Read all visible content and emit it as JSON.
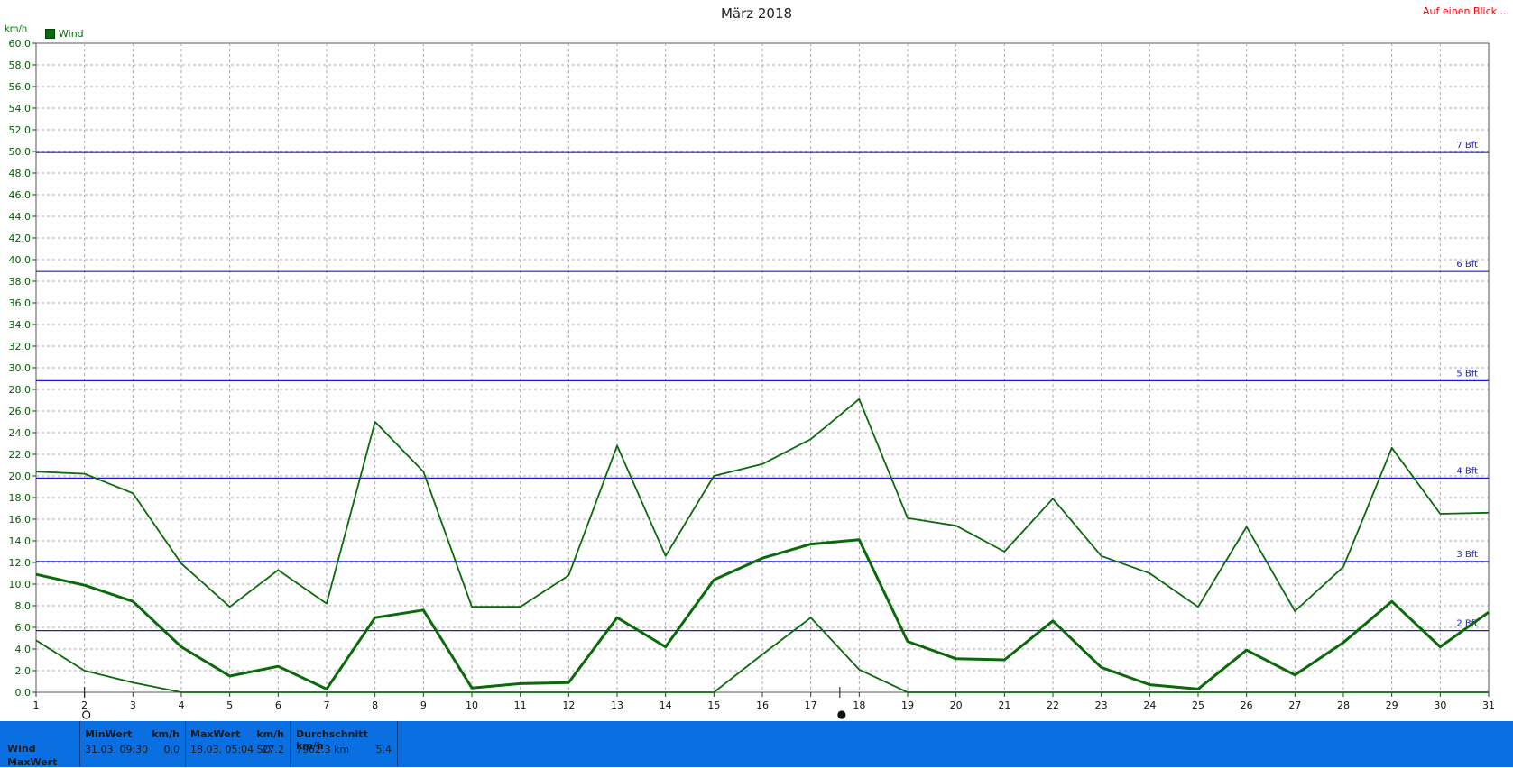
{
  "header": {
    "title": "März 2018",
    "overview_link": "Auf einen Blick ..."
  },
  "legend": {
    "unit": "km/h",
    "series_label": "Wind"
  },
  "colors": {
    "line": "#0a6a0a",
    "beaufort": "#1a1adb",
    "grid": "#a8a8a8",
    "stats_bg": "#0a6fe0",
    "link": "#ff0000"
  },
  "markers": {
    "min_day": 2,
    "max_day": 17.6
  },
  "chart_data": {
    "type": "line",
    "title": "März 2018",
    "ylabel": "km/h",
    "ylim": [
      0,
      60
    ],
    "xlim": [
      1,
      31
    ],
    "ytick_step": 2,
    "grid": true,
    "legend_position": "top-left",
    "x": [
      1,
      2,
      3,
      4,
      5,
      6,
      7,
      8,
      9,
      10,
      11,
      12,
      13,
      14,
      15,
      16,
      17,
      18,
      19,
      20,
      21,
      22,
      23,
      24,
      25,
      26,
      27,
      28,
      29,
      30,
      31
    ],
    "series": [
      {
        "name": "Wind",
        "role": "max",
        "values": [
          20.4,
          20.2,
          18.4,
          11.9,
          7.9,
          11.3,
          8.2,
          25.0,
          20.4,
          7.9,
          7.9,
          10.8,
          22.8,
          12.6,
          20.0,
          21.1,
          23.4,
          27.1,
          16.1,
          15.4,
          13.0,
          17.9,
          12.6,
          11.0,
          7.9,
          15.3,
          7.5,
          11.6,
          22.6,
          16.5,
          16.6
        ]
      },
      {
        "role": "avg",
        "values": [
          10.9,
          9.9,
          8.4,
          4.2,
          1.5,
          2.4,
          0.3,
          6.9,
          7.6,
          0.4,
          0.8,
          0.9,
          6.9,
          4.2,
          10.4,
          12.4,
          13.7,
          14.1,
          4.7,
          3.1,
          3.0,
          6.6,
          2.3,
          0.7,
          0.3,
          3.9,
          1.6,
          4.6,
          8.4,
          4.2,
          7.4
        ]
      },
      {
        "role": "min",
        "values": [
          4.8,
          2.0,
          0.9,
          0.0,
          0.0,
          0.0,
          0.0,
          0.0,
          0.0,
          0.0,
          0.0,
          0.0,
          0.0,
          0.0,
          0.0,
          3.5,
          6.9,
          2.1,
          0.0,
          0.0,
          0.0,
          0.0,
          0.0,
          0.0,
          0.0,
          0.0,
          0.0,
          0.0,
          0.0,
          0.0,
          0.0
        ]
      }
    ],
    "reference_lines": [
      {
        "label": "2 Bft",
        "value": 5.7
      },
      {
        "label": "3 Bft",
        "value": 12.1
      },
      {
        "label": "4 Bft",
        "value": 19.8
      },
      {
        "label": "5 Bft",
        "value": 28.8
      },
      {
        "label": "6 Bft",
        "value": 38.9
      },
      {
        "label": "7 Bft",
        "value": 49.9
      }
    ]
  },
  "stats": {
    "row_labels": [
      "Wind",
      "MaxWert"
    ],
    "min": {
      "header": "MinWert",
      "unit": "km/h",
      "time": "31.03.  09:30",
      "value": "0.0"
    },
    "max": {
      "header": "MaxWert",
      "unit": "km/h",
      "time": "18.03.  05:04 SO",
      "value": "27.2"
    },
    "avg": {
      "header": "Durchschnitt km/h",
      "distance": "7962.3 km",
      "value": "5.4"
    }
  }
}
